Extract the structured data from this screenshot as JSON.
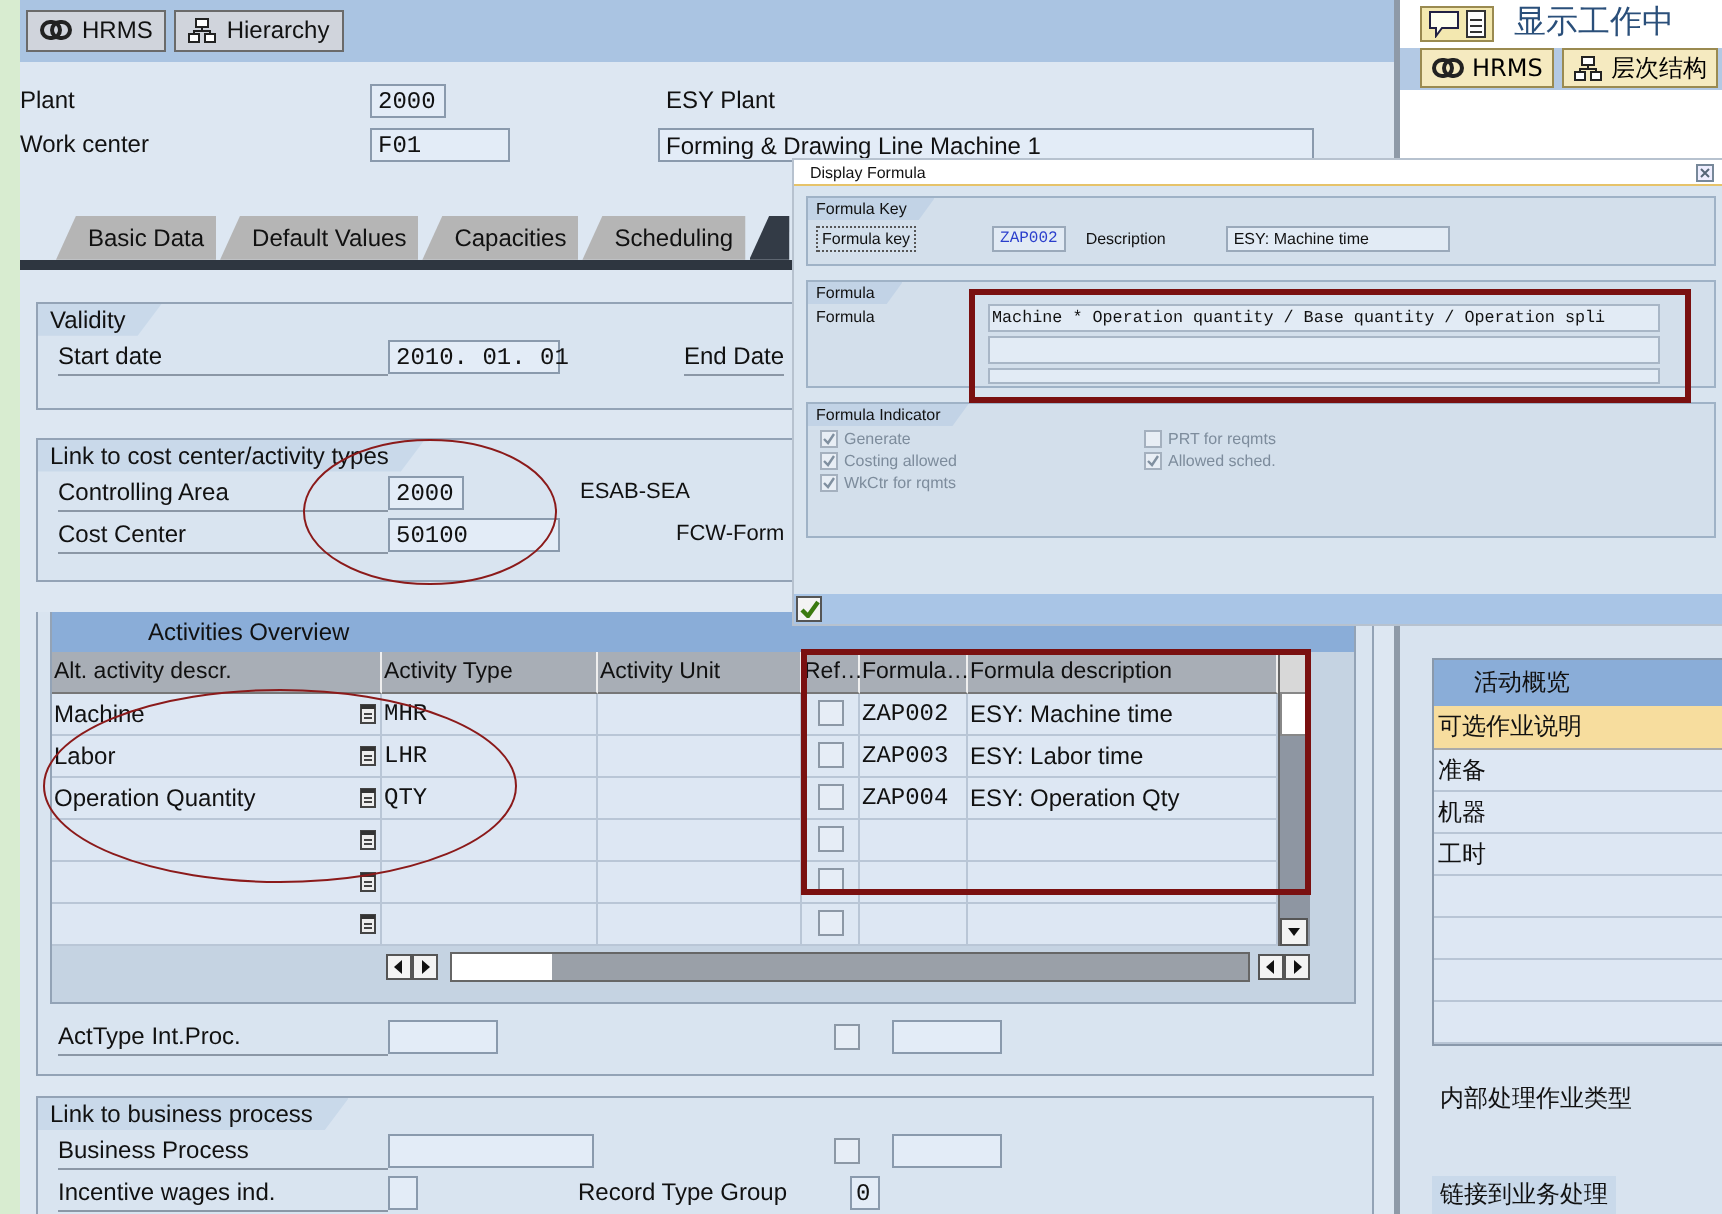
{
  "toolbar": {
    "buttons": [
      {
        "label": "HRMS"
      },
      {
        "label": "Hierarchy"
      }
    ]
  },
  "header": {
    "plant_label": "Plant",
    "plant": "2000",
    "plant_name": "ESY Plant",
    "work_center_label": "Work center",
    "work_center": "F01",
    "work_center_name": "Forming & Drawing Line Machine 1"
  },
  "tabs": [
    {
      "label": "Basic Data",
      "selected": false
    },
    {
      "label": "Default Values",
      "selected": false
    },
    {
      "label": "Capacities",
      "selected": false
    },
    {
      "label": "Scheduling",
      "selected": false
    }
  ],
  "validity": {
    "title": "Validity",
    "start_label": "Start date",
    "start": "2010. 01. 01",
    "end_label": "End Date"
  },
  "cost_link": {
    "title": "Link to cost center/activity types",
    "rows": [
      {
        "label": "Controlling Area",
        "value": "2000",
        "extra": "ESAB-SEA"
      },
      {
        "label": "Cost Center",
        "value": "50100",
        "extra": "FCW-Form"
      }
    ]
  },
  "activities": {
    "title": "Activities Overview",
    "columns": [
      "Alt. activity descr.",
      "Activity Type",
      "Activity Unit",
      "Ref…",
      "Formula…",
      "Formula description"
    ],
    "rows": [
      {
        "desc": "Machine",
        "type": "MHR",
        "ref": false,
        "formula": "ZAP002",
        "formula_desc": "ESY: Machine time"
      },
      {
        "desc": "Labor",
        "type": "LHR",
        "ref": false,
        "formula": "ZAP003",
        "formula_desc": "ESY: Labor time"
      },
      {
        "desc": "Operation Quantity",
        "type": "QTY",
        "ref": false,
        "formula": "ZAP004",
        "formula_desc": "ESY: Operation Qty"
      },
      {
        "ref": false
      },
      {
        "ref": false
      },
      {
        "ref": false
      }
    ]
  },
  "int_proc": {
    "label": "ActType Int.Proc.",
    "checked": false
  },
  "business": {
    "title": "Link to business process",
    "process_label": "Business Process",
    "process_checked": false,
    "incentive_label": "Incentive wages ind.",
    "record_label": "Record Type Group",
    "record": "0"
  },
  "cn_window": {
    "title": "显示工作中",
    "buttons": [
      "HRMS",
      "层次结构"
    ],
    "overview_title": "活动概览",
    "column": "可选作业说明",
    "rows": [
      "准备",
      "机器",
      "工时"
    ],
    "int_proc": "内部处理作业类型",
    "business_title": "链接到业务处理"
  },
  "popup": {
    "title": "Display Formula",
    "key_section": "Formula Key",
    "key_label": "Formula key",
    "key": "ZAP002",
    "desc_label": "Description",
    "desc": "ESY: Machine time",
    "formula_section": "Formula",
    "formula_label": "Formula",
    "formula_lines": [
      "Machine * Operation quantity / Base quantity / Operation spli"
    ],
    "indicator_section": "Formula Indicator",
    "indicators": [
      {
        "label": "Generate",
        "checked": true
      },
      {
        "label": "PRT for reqmts",
        "checked": false
      },
      {
        "label": "Costing allowed",
        "checked": true
      },
      {
        "label": "Allowed sched.",
        "checked": true
      },
      {
        "label": "WkCtr for rqmts",
        "checked": true
      }
    ]
  }
}
